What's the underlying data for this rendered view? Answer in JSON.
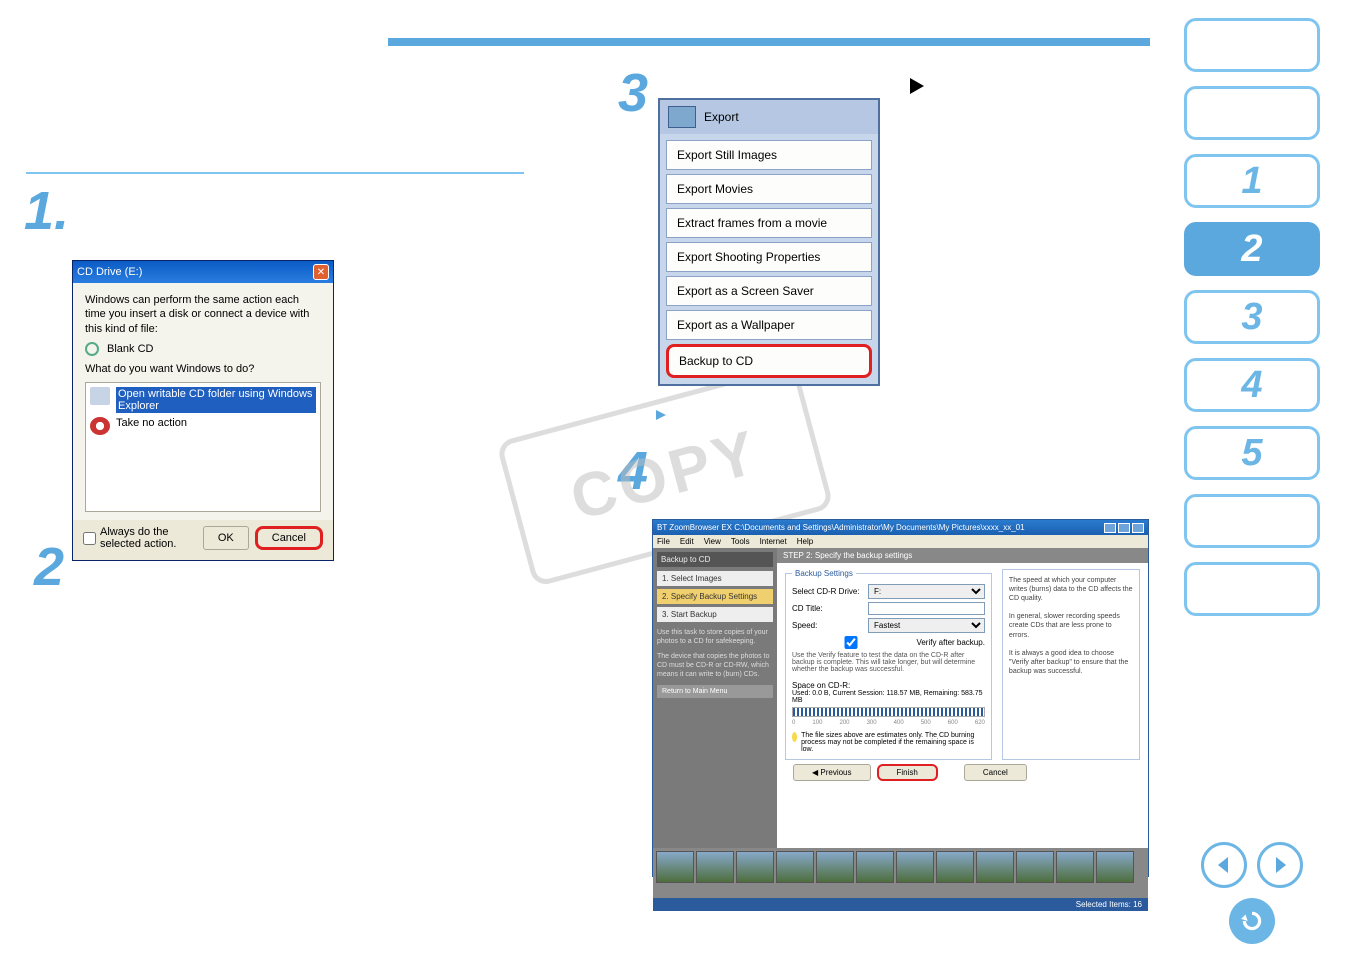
{
  "sidebar": {
    "items": [
      "",
      "",
      "1",
      "2",
      "3",
      "4",
      "5",
      "",
      ""
    ],
    "activeIndex": 3
  },
  "blue_rule": true,
  "watermark": "COPY",
  "step1": {
    "num": "1"
  },
  "step2_sub": "2",
  "step3": {
    "num": "3"
  },
  "step4_sub": "4",
  "triangle_marker": true,
  "cd_dialog": {
    "title": "CD Drive (E:)",
    "intro": "Windows can perform the same action each time you insert a disk or connect a device with this kind of file:",
    "blank": "Blank CD",
    "q": "What do you want Windows to do?",
    "opt_open": "Open writable CD folder using Windows Explorer",
    "opt_none": "Take no action",
    "always": "Always do the selected action.",
    "ok": "OK",
    "cancel": "Cancel"
  },
  "export_menu": {
    "header": "Export",
    "items": [
      "Export Still Images",
      "Export Movies",
      "Extract frames from a movie",
      "Export Shooting Properties",
      "Export as a Screen Saver",
      "Export as a Wallpaper",
      "Backup to CD"
    ],
    "highlightIndex": 6
  },
  "wizard": {
    "title": "BT ZoomBrowser EX    C:\\Documents and Settings\\Administrator\\My Documents\\My Pictures\\xxxx_xx_01",
    "menus": [
      "File",
      "Edit",
      "View",
      "Tools",
      "Internet",
      "Help"
    ],
    "left_header": "Backup to CD",
    "left_steps": [
      "1. Select Images",
      "2. Specify Backup Settings",
      "3. Start Backup"
    ],
    "left_current": 1,
    "left_desc": "Use this task to store copies of your photos to a CD for safekeeping.",
    "left_desc2": "The device that copies the photos to CD must be CD-R or CD-RW, which means it can write to (burn) CDs.",
    "left_return": "Return to Main Menu",
    "step_banner": "STEP 2: Specify the backup settings",
    "legend": "Backup Settings",
    "row_drive": "Select CD-R Drive:",
    "drive_value": "F:",
    "row_title": "CD Title:",
    "title_value": "",
    "row_speed": "Speed:",
    "speed_value": "Fastest",
    "verify": "Verify after backup.",
    "verify_desc": "Use the Verify feature to test the data on the CD-R after backup is complete. This will take longer, but will determine whether the backup was successful.",
    "side_info1": "The speed at which your computer writes (burns) data to the CD affects the CD quality.",
    "side_info2": "In general, slower recording speeds create CDs that are less prone to errors.",
    "side_info3": "It is always a good idea to choose \"Verify after backup\" to ensure that the backup was successful.",
    "space_label": "Space on CD-R:",
    "space_text": "Used: 0.0 B, Current Session: 118.57 MB, Remaining: 583.75 MB",
    "ticks": [
      "0",
      "100",
      "200",
      "300",
      "400",
      "500",
      "600",
      "620"
    ],
    "warn": "The file sizes above are estimates only. The CD burning process may not be completed if the remaining space is low.",
    "prev": "Previous",
    "finish": "Finish",
    "cancel": "Cancel",
    "thumb_count": 12,
    "status": "Selected Items: 16"
  }
}
